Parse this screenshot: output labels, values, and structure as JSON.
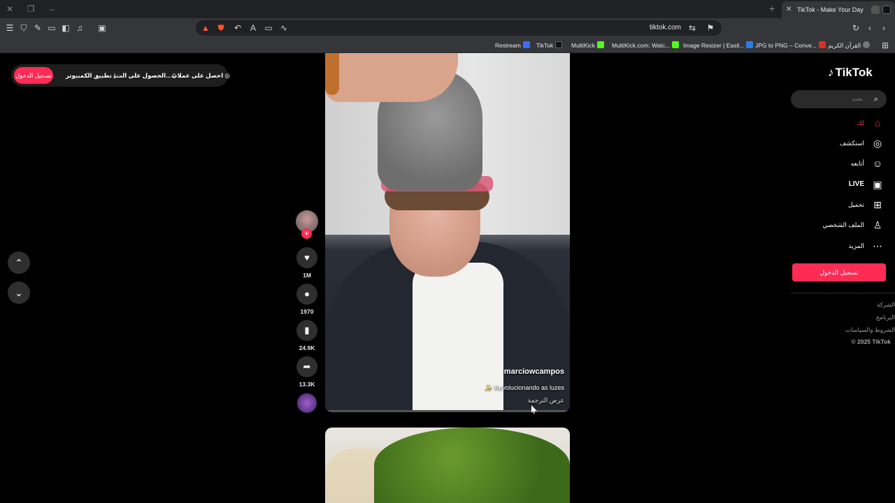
{
  "browser": {
    "tab_title": "TikTok - Make Your Day",
    "url": "tiktok.com",
    "bookmarks": [
      {
        "label": "Restream",
        "color": "#3b6df6"
      },
      {
        "label": "TikTok",
        "color": "#111111"
      },
      {
        "label": "MultiKick",
        "color": "#53fc18"
      },
      {
        "label": "MultiKick.com: Watc...",
        "color": "#53fc18"
      },
      {
        "label": "Image Resizer | Easil...",
        "color": "#2a7de1"
      },
      {
        "label": "JPG to PNG – Conve...",
        "color": "#d93025"
      },
      {
        "label": "القرآن الكريم",
        "color": "#777777"
      }
    ]
  },
  "topbar": {
    "login": "تسجيل الدخول",
    "desktop_app": "تطبيق الكمبيوتر",
    "get_app": "الحصول على الت...",
    "get_coins": "احصل على عملات"
  },
  "video": {
    "username": "marciowcampos",
    "description": "✨ Revolucionando as luzes",
    "translate": "عرض الترجمة"
  },
  "actions": {
    "likes": "1M",
    "comments": "1970",
    "saves": "24.9K",
    "shares": "13.3K"
  },
  "sidebar": {
    "logo": "TikTok",
    "search_placeholder": "بحث",
    "items": [
      {
        "label": "لك",
        "icon": "home-icon"
      },
      {
        "label": "استكشف",
        "icon": "compass-icon"
      },
      {
        "label": "أتابعه",
        "icon": "following-icon"
      },
      {
        "label": "LIVE",
        "icon": "live-icon"
      },
      {
        "label": "تحميل",
        "icon": "upload-icon"
      },
      {
        "label": "الملف الشخصي",
        "icon": "profile-icon"
      },
      {
        "label": "المزيد",
        "icon": "more-icon"
      }
    ],
    "login": "تسجيل الدخول",
    "footer": [
      "الشركة",
      "البرنامج",
      "الشروط والسياسات",
      "© 2025 TikTok"
    ]
  },
  "colors": {
    "accent": "#fe2c55",
    "background": "#000000"
  }
}
